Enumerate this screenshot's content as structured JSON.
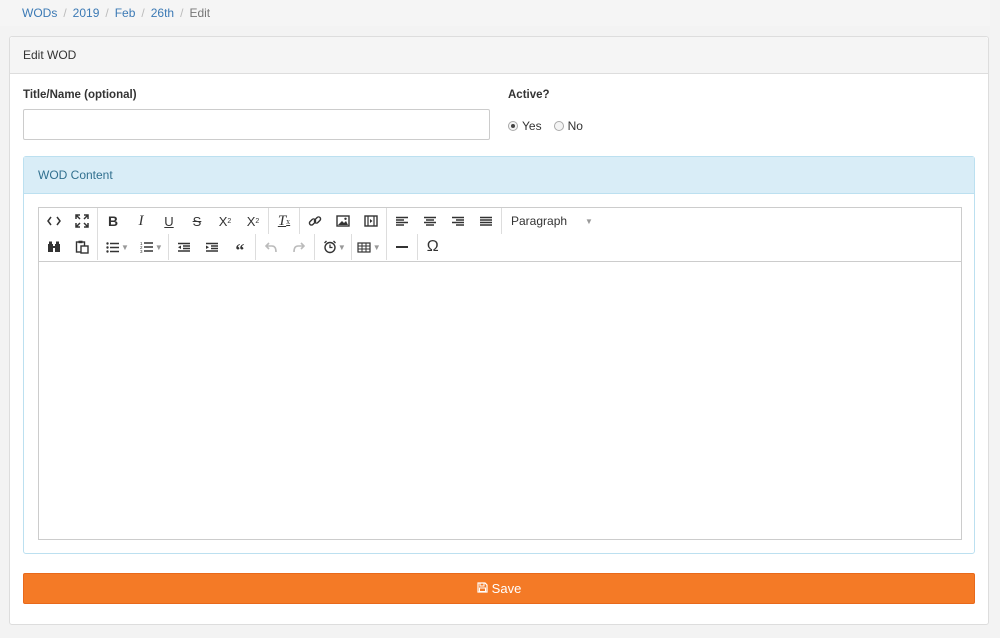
{
  "breadcrumb": {
    "items": [
      "WODs",
      "2019",
      "Feb",
      "26th"
    ],
    "current": "Edit",
    "separator": "/"
  },
  "panel": {
    "title": "Edit WOD"
  },
  "form": {
    "title_label": "Title/Name (optional)",
    "title_value": "",
    "title_placeholder": "",
    "active_label": "Active?",
    "active_options": [
      "Yes",
      "No"
    ],
    "active_selected": "Yes"
  },
  "content": {
    "heading": "WOD Content",
    "format_select": "Paragraph",
    "toolbar_icons": [
      "code-icon",
      "fullscreen-icon",
      "bold-icon",
      "italic-icon",
      "underline-icon",
      "strikethrough-icon",
      "subscript-icon",
      "superscript-icon",
      "clear-format-icon",
      "link-icon",
      "image-icon",
      "media-icon",
      "align-left-icon",
      "align-center-icon",
      "align-right-icon",
      "align-justify-icon",
      "find-replace-icon",
      "paste-icon",
      "bullet-list-icon",
      "numbered-list-icon",
      "outdent-icon",
      "indent-icon",
      "blockquote-icon",
      "undo-icon",
      "redo-icon",
      "time-icon",
      "table-icon",
      "horizontal-rule-icon",
      "omega-icon"
    ]
  },
  "actions": {
    "save_label": "Save"
  },
  "colors": {
    "accent": "#f47a26",
    "info_bg": "#d9edf7",
    "info_text": "#31708f",
    "link": "#3c7ab5"
  }
}
